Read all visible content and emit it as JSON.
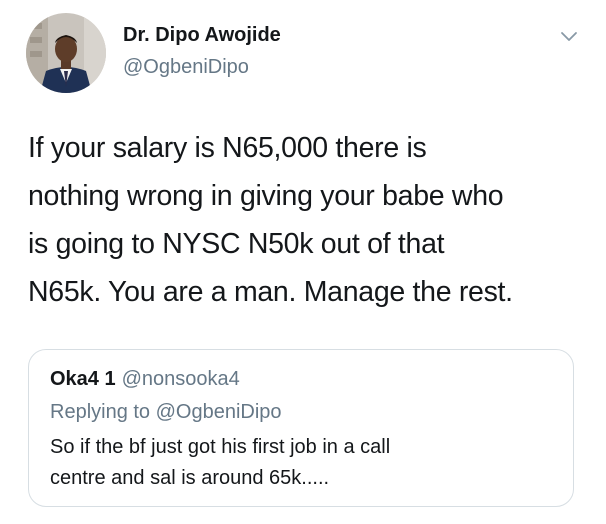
{
  "author": {
    "display_name": "Dr. Dipo Awojide",
    "handle": "@OgbeniDipo",
    "avatar_icon": "profile-photo"
  },
  "menu": {
    "icon": "chevron-down-icon"
  },
  "tweet": {
    "lines": [
      "If your salary is N65,000 there is",
      "nothing wrong in giving your babe who",
      "is going to NYSC N50k out of that",
      "N65k. You are a man. Manage the rest."
    ]
  },
  "quoted_tweet": {
    "display_name": "Oka4 1",
    "handle": "@nonsooka4",
    "replying_to": "Replying to @OgbeniDipo",
    "lines": [
      "So if the bf just got his first job in a call",
      "centre and sal is around 65k....."
    ]
  },
  "colors": {
    "primary_text": "#14171a",
    "secondary_text": "#657786",
    "border": "#d7dee3"
  }
}
